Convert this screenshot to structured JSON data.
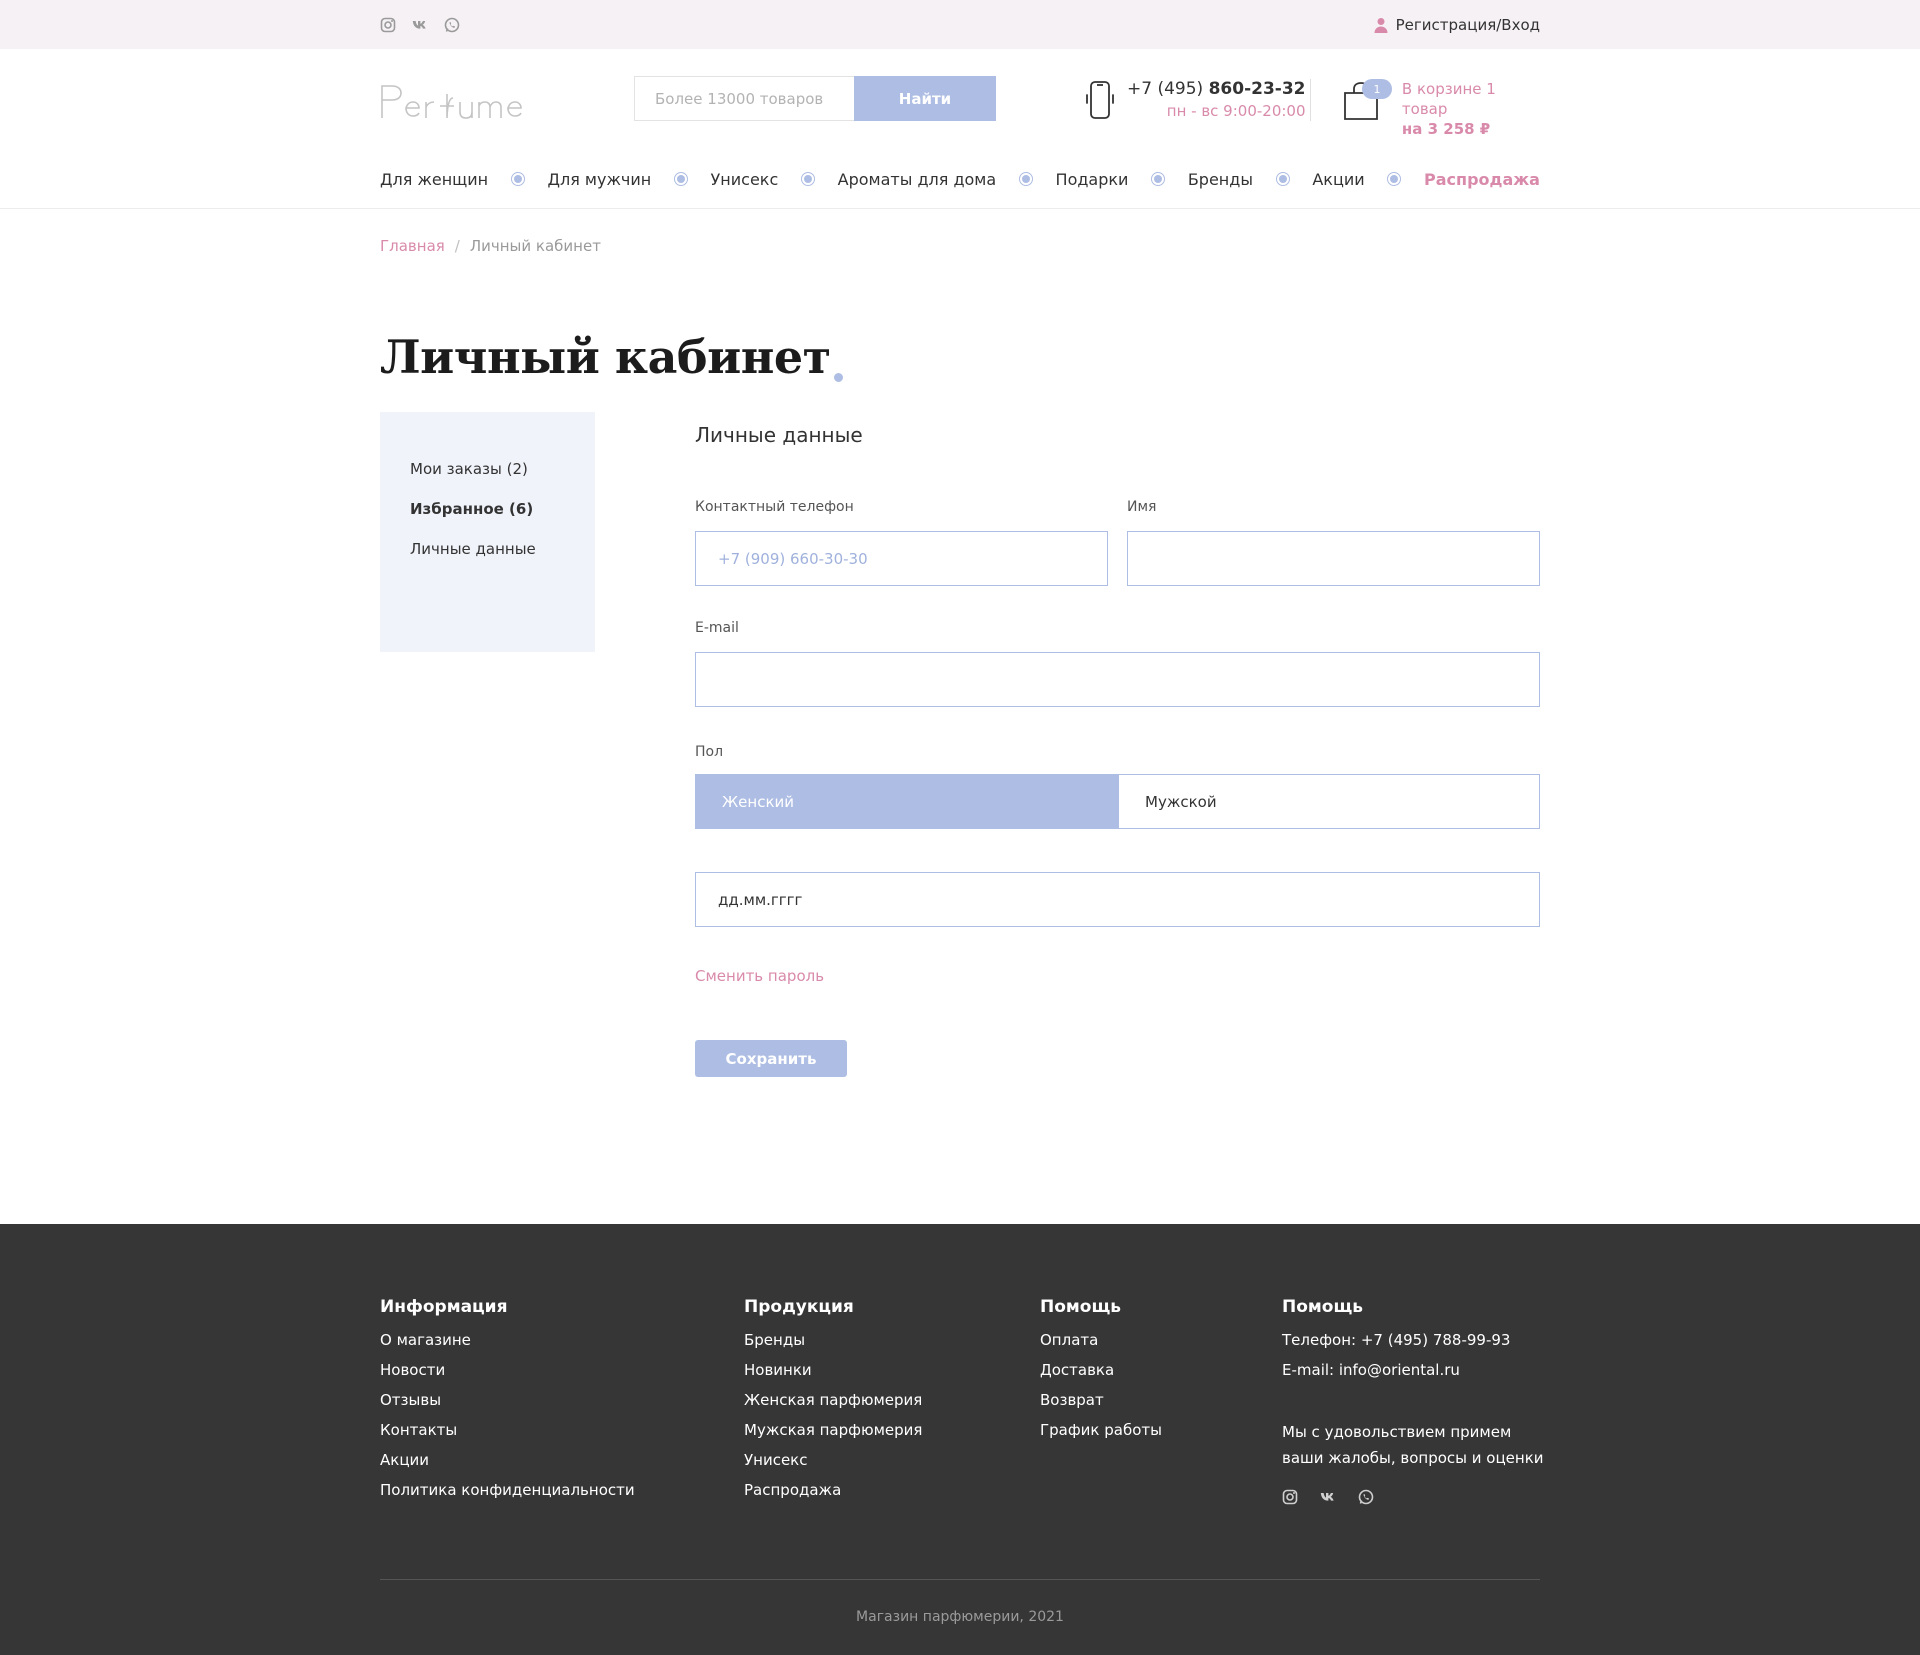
{
  "topbar": {
    "auth_label": "Регистрация/Вход",
    "socials": [
      "instagram-icon",
      "vk-icon",
      "whatsapp-icon"
    ]
  },
  "header": {
    "logo_text": "Perfume",
    "search": {
      "placeholder": "Более 13000 товаров",
      "button_label": "Найти"
    },
    "phone": {
      "prefix": "+7 (495) ",
      "number": "860-23-32",
      "hours": "пн - вс 9:00-20:00"
    },
    "cart": {
      "count": "1",
      "line1": "В корзине 1 товар",
      "line2": "на 3 258 ₽"
    }
  },
  "nav": {
    "items": [
      {
        "label": "Для женщин"
      },
      {
        "label": "Для мужчин"
      },
      {
        "label": "Унисекс"
      },
      {
        "label": "Ароматы для дома"
      },
      {
        "label": "Подарки"
      },
      {
        "label": "Бренды"
      },
      {
        "label": "Акции"
      },
      {
        "label": "Распродажа"
      }
    ]
  },
  "breadcrumb": {
    "home": "Главная",
    "separator": "/",
    "current": "Личный кабинет"
  },
  "page_title": "Личный кабинет",
  "sidebar": {
    "items": [
      {
        "label": "Мои заказы (2)"
      },
      {
        "label": "Избранное (6)"
      },
      {
        "label": "Личные данные"
      }
    ]
  },
  "form": {
    "title": "Личные данные",
    "phone_label": "Контактный телефон",
    "phone_placeholder": "+7 (909) 660-30-30",
    "name_label": "Имя",
    "name_value": "",
    "email_label": "E-mail",
    "email_value": "",
    "gender_label": "Пол",
    "gender_female": "Женский",
    "gender_male": "Мужской",
    "gender_selected": "Женский",
    "date_placeholder": "дд.мм.гггг",
    "change_password": "Сменить пароль",
    "save_label": "Сохранить"
  },
  "footer": {
    "col1": {
      "title": "Информация",
      "links": [
        "О магазине",
        "Новости",
        "Отзывы",
        "Контакты",
        "Акции",
        "Политика конфиденциальности"
      ]
    },
    "col2": {
      "title": "Продукция",
      "links": [
        "Бренды",
        "Новинки",
        "Женская парфюмерия",
        "Мужская парфюмерия",
        "Унисекс",
        "Распродажа"
      ]
    },
    "col3": {
      "title": "Помощь",
      "links": [
        "Оплата",
        "Доставка",
        "Возврат",
        "График работы"
      ]
    },
    "col4": {
      "title": "Помощь",
      "phone": "Телефон: +7 (495) 788-99-93",
      "email": "E-mail: info@oriental.ru",
      "note": "Мы с удовольствием примем ваши жалобы, вопросы и оценки"
    },
    "copyright": "Магазин парфюмерии, 2021"
  },
  "colors": {
    "accent": "#aebde3",
    "pink": "#d98aaa",
    "footer_bg": "#363636",
    "topbar_bg": "#f6f1f5",
    "sidebar_bg": "#f1f3fb"
  }
}
